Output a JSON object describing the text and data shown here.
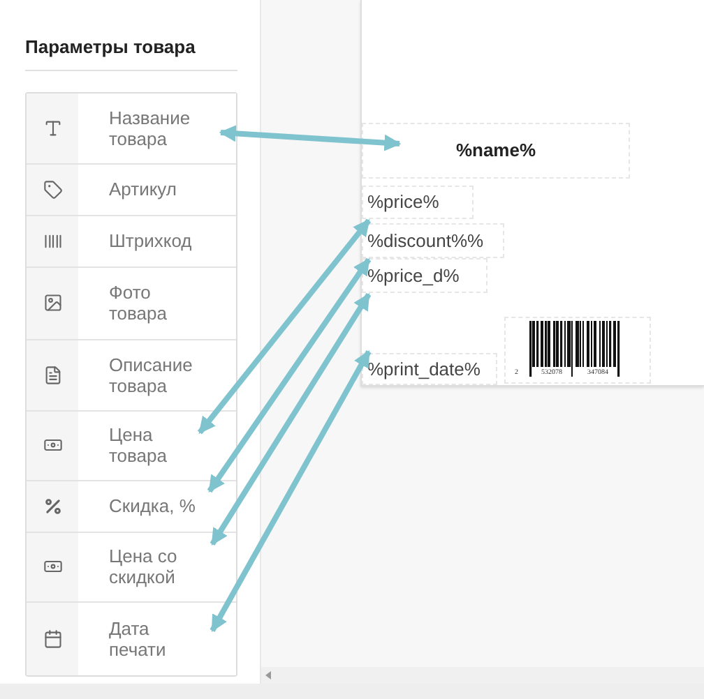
{
  "sidebar": {
    "title": "Параметры товара",
    "items": [
      {
        "kind": "text",
        "label": "Название товара"
      },
      {
        "kind": "tag",
        "label": "Артикул"
      },
      {
        "kind": "barcode",
        "label": "Штрихкод"
      },
      {
        "kind": "image",
        "label": "Фото товара"
      },
      {
        "kind": "document",
        "label": "Описание товара"
      },
      {
        "kind": "money",
        "label": "Цена товара"
      },
      {
        "kind": "percent",
        "label": "Скидка, %"
      },
      {
        "kind": "money",
        "label": "Цена со скидкой"
      },
      {
        "kind": "calendar",
        "label": "Дата печати"
      }
    ]
  },
  "label": {
    "fields": [
      {
        "kind": "title",
        "text": "%name%"
      },
      {
        "kind": "text",
        "text": "%price%"
      },
      {
        "kind": "text",
        "text": "%discount%%"
      },
      {
        "kind": "text",
        "text": "%price_d%"
      },
      {
        "kind": "text",
        "text": "%print_date%"
      },
      {
        "kind": "barcode",
        "digits": [
          "2",
          "532078",
          "347084"
        ]
      }
    ]
  }
}
